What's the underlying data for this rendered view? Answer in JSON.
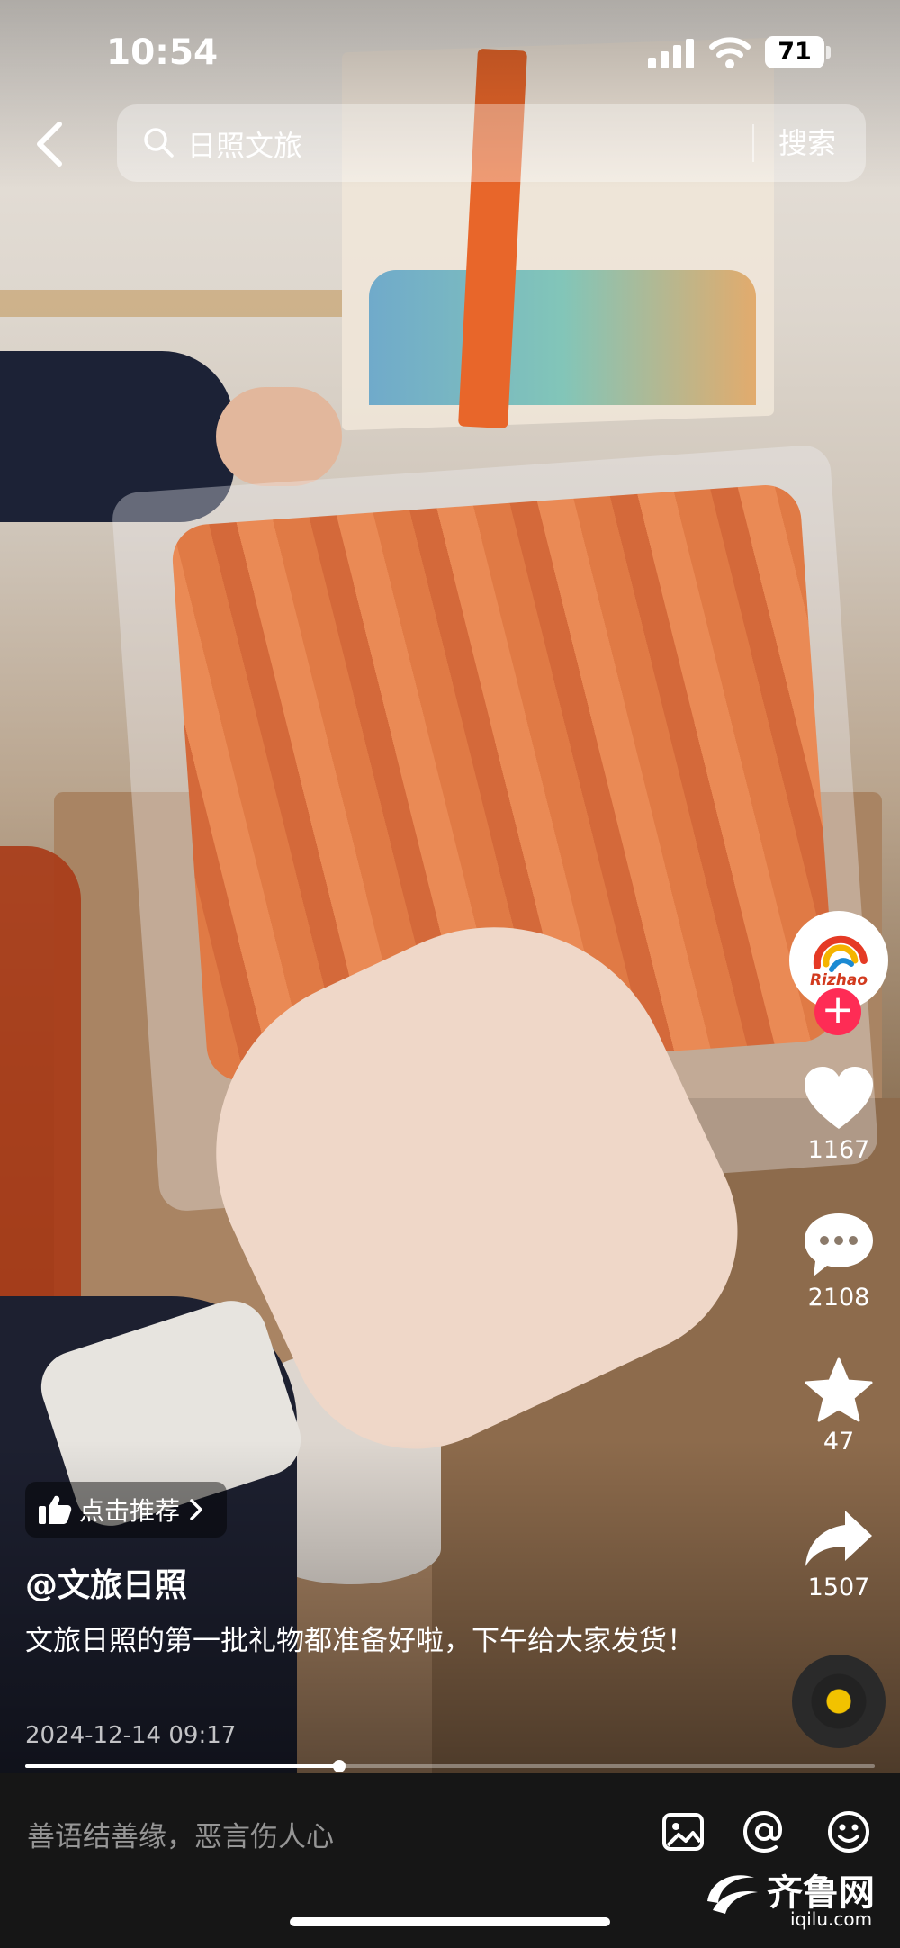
{
  "status_bar": {
    "time": "10:54",
    "battery": "71"
  },
  "search": {
    "query": "日照文旅",
    "button_label": "搜索"
  },
  "rail": {
    "avatar_text": "Rizhao",
    "follow_symbol": "+",
    "like_count": "1167",
    "comment_count": "2108",
    "favorite_count": "47",
    "share_count": "1507"
  },
  "post": {
    "recommend_label": "点击推荐",
    "author": "@文旅日照",
    "caption": "文旅日照的第一批礼物都准备好啦，下午给大家发货！",
    "date": "2024-12-14 09:17",
    "progress_fraction": 0.37
  },
  "comment_bar": {
    "placeholder": "善语结善缘，恶言伤人心"
  },
  "watermark": {
    "name": "齐鲁网",
    "url": "iqilu.com"
  },
  "icons": [
    "back-arrow-icon",
    "search-icon",
    "heart-icon",
    "comment-icon",
    "star-icon",
    "share-icon",
    "music-disc-icon",
    "thumbs-up-icon",
    "chevron-right-icon",
    "image-icon",
    "at-icon",
    "emoji-icon"
  ],
  "colors": {
    "follow": "#fe2c55",
    "disc_center": "#f2c200"
  }
}
